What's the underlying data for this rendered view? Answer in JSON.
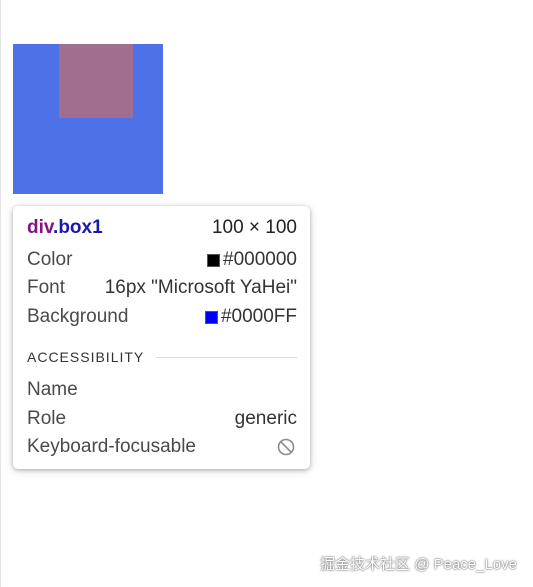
{
  "element_box": {
    "color": "#4d72e8",
    "inner_color": "#a06e8e"
  },
  "tooltip": {
    "tag": "div",
    "class_name": ".box1",
    "dimensions": "100 × 100",
    "rows": {
      "color_label": "Color",
      "color_value": "#000000",
      "font_label": "Font",
      "font_value": "16px \"Microsoft YaHei\"",
      "background_label": "Background",
      "background_value": "#0000FF"
    },
    "accessibility": {
      "title": "ACCESSIBILITY",
      "name_label": "Name",
      "role_label": "Role",
      "role_value": "generic",
      "keyboard_label": "Keyboard-focusable",
      "keyboard_icon": "ban-icon"
    }
  },
  "watermark": "掘金技术社区 @ Peace_Love"
}
